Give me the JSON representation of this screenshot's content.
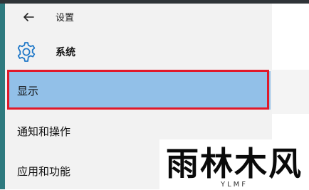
{
  "header": {
    "title": "设置",
    "back_icon": "back-arrow-icon"
  },
  "section": {
    "title": "系统",
    "icon": "gear-icon",
    "icon_color": "#1f78c8"
  },
  "nav": {
    "items": [
      {
        "label": "显示",
        "selected": true
      },
      {
        "label": "通知和操作",
        "selected": false
      },
      {
        "label": "应用和功能",
        "selected": false
      }
    ],
    "selected_color": "#92c0e8",
    "highlight_color": "#e0192a"
  },
  "watermark": {
    "main": "雨林木风",
    "sub": "YLMF"
  }
}
